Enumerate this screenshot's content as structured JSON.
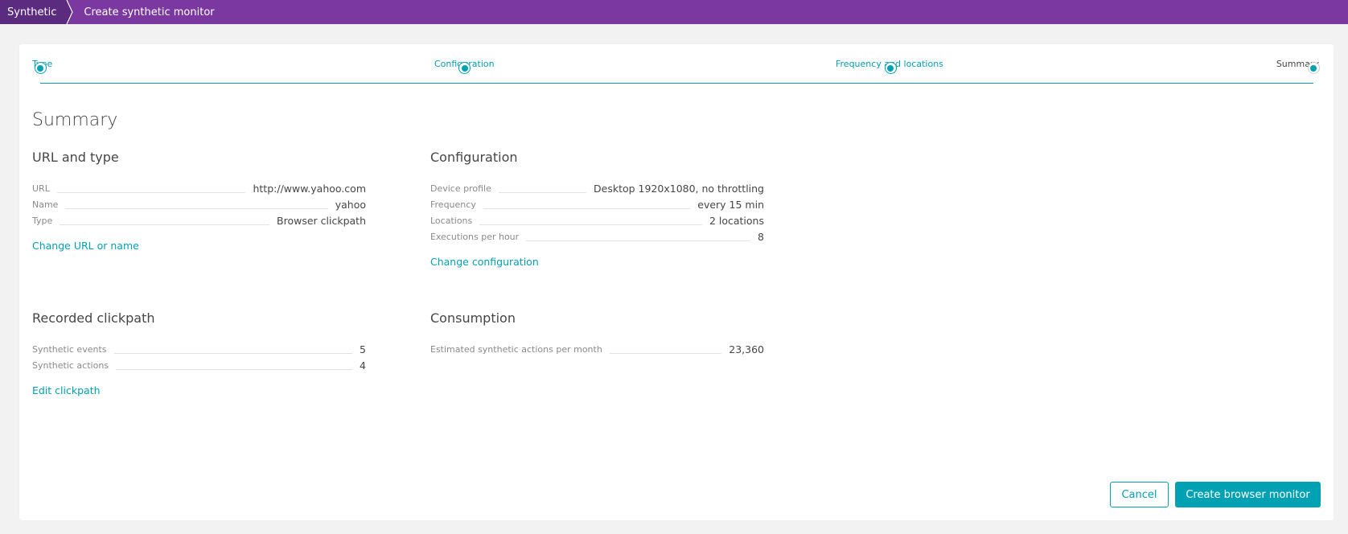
{
  "header": {
    "breadcrumb_root": "Synthetic",
    "breadcrumb_current": "Create synthetic monitor"
  },
  "stepper": {
    "steps": [
      {
        "label": "Type",
        "state": "completed"
      },
      {
        "label": "Configuration",
        "state": "completed"
      },
      {
        "label": "Frequency and locations",
        "state": "completed"
      },
      {
        "label": "Summary",
        "state": "current"
      }
    ]
  },
  "page_title": "Summary",
  "sections": {
    "url_type": {
      "title": "URL and type",
      "rows": [
        {
          "label": "URL",
          "value": "http://www.yahoo.com"
        },
        {
          "label": "Name",
          "value": "yahoo"
        },
        {
          "label": "Type",
          "value": "Browser clickpath"
        }
      ],
      "link": "Change URL or name"
    },
    "configuration": {
      "title": "Configuration",
      "rows": [
        {
          "label": "Device profile",
          "value": "Desktop 1920x1080, no throttling"
        },
        {
          "label": "Frequency",
          "value": "every 15 min"
        },
        {
          "label": "Locations",
          "value": "2 locations"
        },
        {
          "label": "Executions per hour",
          "value": "8"
        }
      ],
      "link": "Change configuration"
    },
    "clickpath": {
      "title": "Recorded clickpath",
      "rows": [
        {
          "label": "Synthetic events",
          "value": "5"
        },
        {
          "label": "Synthetic actions",
          "value": "4"
        }
      ],
      "link": "Edit clickpath"
    },
    "consumption": {
      "title": "Consumption",
      "rows": [
        {
          "label": "Estimated synthetic actions per month",
          "value": "23,360"
        }
      ]
    }
  },
  "actions": {
    "cancel_label": "Cancel",
    "create_label": "Create browser monitor"
  },
  "colors": {
    "header": "#7c38a1",
    "header_root": "#5b2b7f",
    "accent": "#00a1b2"
  }
}
